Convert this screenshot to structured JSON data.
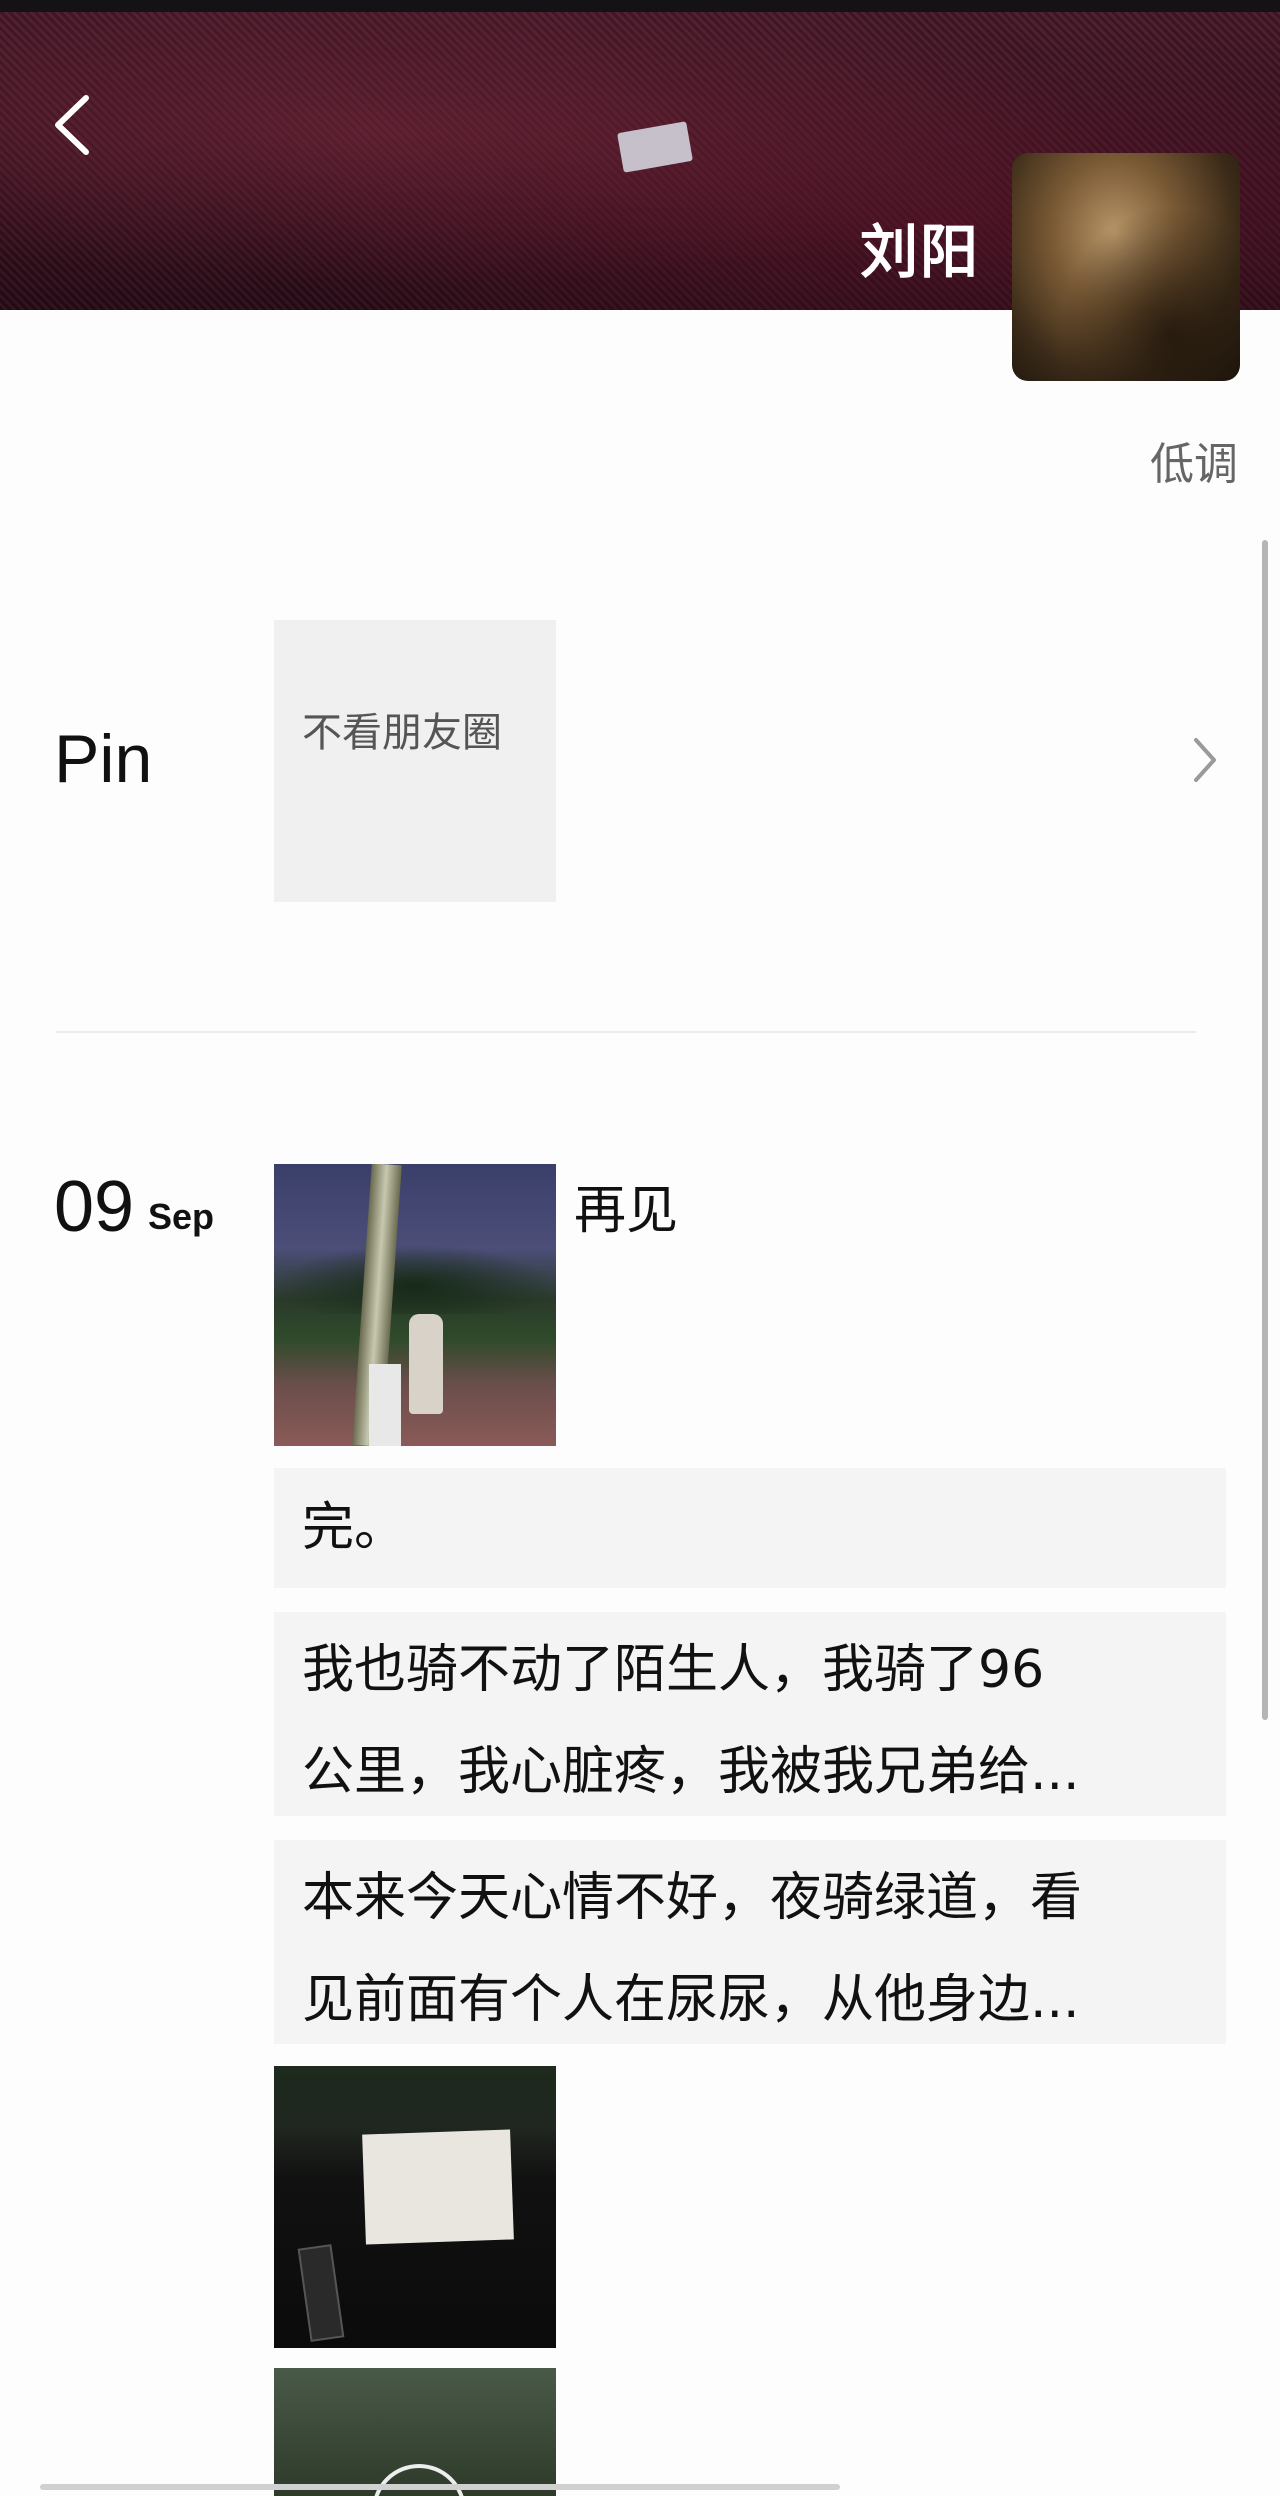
{
  "profile": {
    "name": "刘阳",
    "signature": "低调"
  },
  "pin": {
    "label": "Pin",
    "card_text": "不看朋友圈"
  },
  "timeline": {
    "date_day": "09",
    "date_month": "Sep",
    "photo_caption": "再见",
    "posts": [
      {
        "line1": "完。",
        "line2": ""
      },
      {
        "line1": "我也骑不动了陌生人，我骑了96",
        "line2": "公里，我心脏疼，我被我兄弟给..."
      },
      {
        "line1": "本来今天心情不好，夜骑绿道，看",
        "line2": "见前面有个人在尿尿，从他身边..."
      }
    ]
  },
  "icons": {
    "back": "chevron-left-icon",
    "pin_arrow": "chevron-right-icon",
    "video": "play-icon"
  },
  "colors": {
    "cover": "#3a1220",
    "card_bg": "#f4f4f4",
    "text": "#111111"
  }
}
